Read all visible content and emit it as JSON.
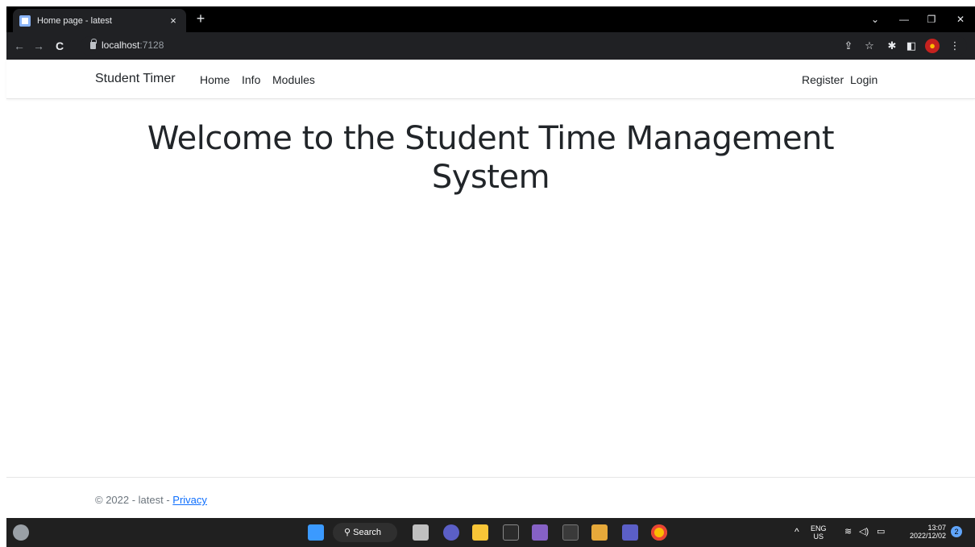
{
  "browser": {
    "tab_title": "Home page - latest",
    "tab_close": "×",
    "new_tab": "+",
    "url_host": "localhost",
    "url_port": ":7128"
  },
  "site": {
    "brand": "Student Timer",
    "nav_left": [
      "Home",
      "Info",
      "Modules"
    ],
    "nav_right": [
      "Register",
      "Login"
    ],
    "hero_line1": "Welcome to the Student Time Management",
    "hero_line2": "System",
    "footer_text": "© 2022 - latest - ",
    "footer_link": "Privacy"
  },
  "taskbar": {
    "search_label": "Search",
    "lang_line1": "ENG",
    "lang_line2": "US",
    "time": "13:07",
    "date": "2022/12/02",
    "notification_count": "2"
  },
  "colors": {
    "link": "#0d6efd",
    "text": "#212529",
    "muted": "#6c757d"
  }
}
